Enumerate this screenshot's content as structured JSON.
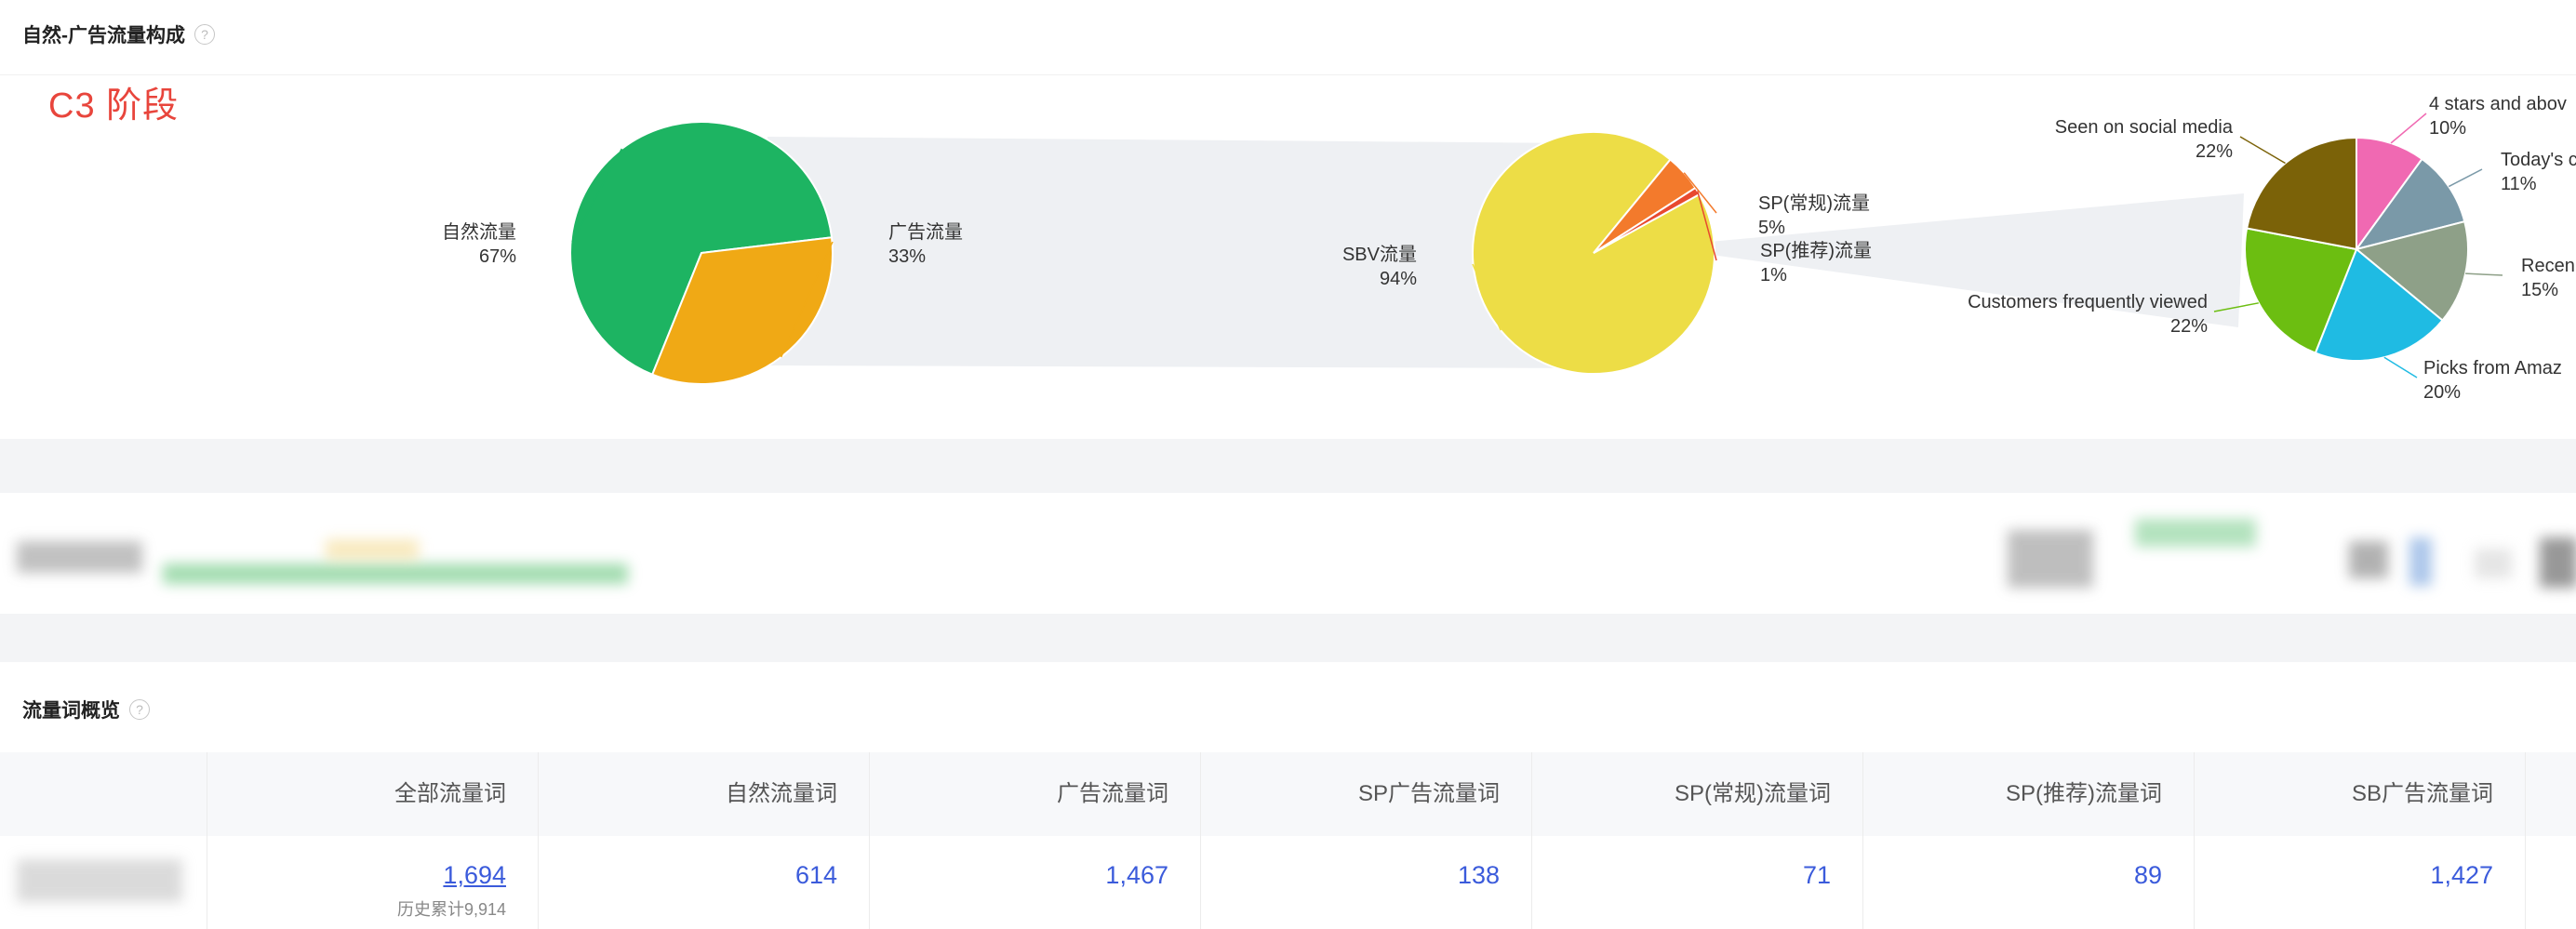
{
  "composition": {
    "title": "自然-广告流量构成",
    "stage_label": "C3 阶段",
    "pie1": [
      {
        "label": "自然流量",
        "percent_text": "67%",
        "value": 67,
        "color": "#1db462"
      },
      {
        "label": "广告流量",
        "percent_text": "33%",
        "value": 33,
        "color": "#f0a915"
      }
    ],
    "pie2": [
      {
        "label": "SBV流量",
        "percent_text": "94%",
        "value": 94,
        "color": "#eddd46"
      },
      {
        "label": "SP(常规)流量",
        "percent_text": "5%",
        "value": 5,
        "color": "#f37a2c"
      },
      {
        "label": "SP(推荐)流量",
        "percent_text": "1%",
        "value": 1,
        "color": "#e8492f"
      }
    ],
    "pie3": [
      {
        "label": "4 stars and abov",
        "percent_text": "10%",
        "value": 10,
        "color": "#f069b2"
      },
      {
        "label": "Today's c",
        "percent_text": "11%",
        "value": 11,
        "color": "#7a99a8"
      },
      {
        "label": "Recen",
        "percent_text": "15%",
        "value": 15,
        "color": "#8ea088"
      },
      {
        "label": "Picks from Amaz",
        "percent_text": "20%",
        "value": 20,
        "color": "#1fbbe3"
      },
      {
        "label": "Customers frequently viewed",
        "percent_text": "22%",
        "value": 22,
        "color": "#6cbe11"
      },
      {
        "label": "Seen on social media",
        "percent_text": "22%",
        "value": 22,
        "color": "#7b6208"
      }
    ]
  },
  "overview": {
    "title": "流量词概览",
    "columns": [
      "全部流量词",
      "自然流量词",
      "广告流量词",
      "SP广告流量词",
      "SP(常规)流量词",
      "SP(推荐)流量词",
      "SB广告流量词"
    ],
    "values": [
      "1,694",
      "614",
      "1,467",
      "138",
      "71",
      "89",
      "1,427"
    ],
    "history_note": "历史累计9,914"
  }
}
